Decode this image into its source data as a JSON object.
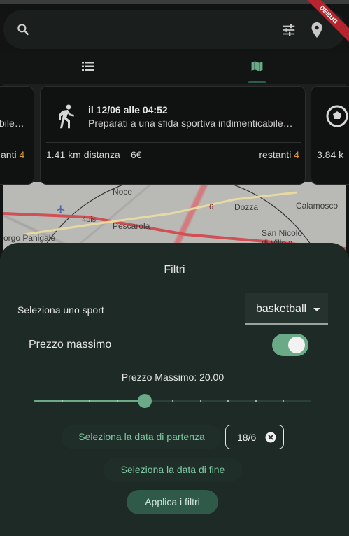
{
  "search": {
    "placeholder": ""
  },
  "debug_banner": "DEBUG",
  "tabs": [
    {
      "name": "list-view",
      "icon": "list-icon",
      "active": false
    },
    {
      "name": "map-view",
      "icon": "map-icon",
      "active": true
    }
  ],
  "cards": {
    "left": {
      "subtitle": "bile…",
      "remaining_label": "anti",
      "remaining_count": "4"
    },
    "center": {
      "title": "il 12/06 alle 04:52",
      "subtitle": "Preparati a una sfida sportiva indimenticabile…",
      "distance": "1.41 km distanza",
      "price": "6€",
      "remaining_label": "restanti",
      "remaining_count": "4"
    },
    "right": {
      "distance": "3.84 k"
    }
  },
  "map": {
    "labels": [
      "Noce",
      "Pescarola",
      "Dozza",
      "Calamosco",
      "San Nicolò",
      "di Villola",
      "orgo Panigale",
      "4bis",
      "6"
    ]
  },
  "filters": {
    "title": "Filtri",
    "sport_label": "Seleziona uno sport",
    "sport_value": "basketball",
    "max_price_label": "Prezzo massimo",
    "max_price_enabled": true,
    "slider_label": "Prezzo Massimo: 20.00",
    "slider_value_fraction": 0.4,
    "start_date_button": "Seleziona la data di partenza",
    "start_date_value": "18/6",
    "end_date_button": "Seleziona la data di fine",
    "apply_button": "Applica i filtri"
  },
  "colors": {
    "accent": "#6aaa87",
    "sheet_bg": "#1d2a26",
    "orange": "#e0922f"
  }
}
